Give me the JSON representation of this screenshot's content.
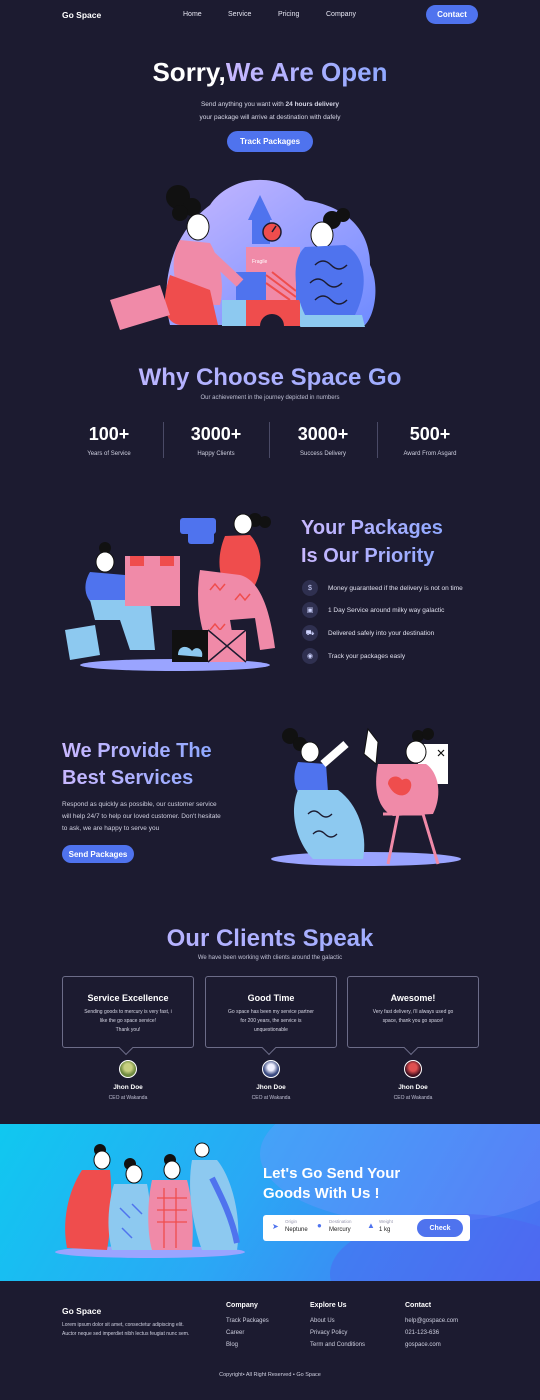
{
  "nav": {
    "logo": "Go Space",
    "links": [
      "Home",
      "Service",
      "Pricing",
      "Company"
    ],
    "contact": "Contact"
  },
  "hero": {
    "title_a": "Sorry,",
    "title_b": "We Are Open",
    "sub_pre": "Send anything you want with ",
    "sub_bold": "24 hours delivery",
    "sub_line2": "your package will arrive at destination with dafely",
    "cta": "Track Packages",
    "block_labels": [
      "Fragile",
      "Fragile"
    ]
  },
  "why": {
    "title": "Why Choose Space Go",
    "sub": "Our achievement in the journey depicted in numbers",
    "stats": [
      {
        "num": "100+",
        "label": "Years of Service"
      },
      {
        "num": "3000+",
        "label": "Happy Clients"
      },
      {
        "num": "3000+",
        "label": "Success Delivery"
      },
      {
        "num": "500+",
        "label": "Award From Asgard"
      }
    ]
  },
  "priority": {
    "title_l1": "Your Packages",
    "title_l2": "Is Our Priority",
    "features": [
      {
        "icon": "dollar-icon",
        "glyph": "$",
        "text": "Money guaranteed if the delivery is not on time"
      },
      {
        "icon": "box-icon",
        "glyph": "▣",
        "text": "1 Day Service around milky way galactic"
      },
      {
        "icon": "truck-icon",
        "glyph": "⛟",
        "text": "Delivered safely into your destination"
      },
      {
        "icon": "eye-icon",
        "glyph": "◉",
        "text": "Track your packages easly"
      }
    ]
  },
  "services": {
    "title_l1": "We Provide The",
    "title_l2": "Best Services",
    "body_l1": "Respond as quickly as possible, our customer service",
    "body_l2": "will help 24/7 to help our loved customer. Don't hesitate",
    "body_l3": "to ask, we are happy to serve you",
    "cta": "Send Packages"
  },
  "clients": {
    "title": "Our Clients Speak",
    "sub": "We have been working with clients around the galactic",
    "reviews": [
      {
        "title": "Service Excellence",
        "l1": "Sending goods to mercury is very fast, i",
        "l2": "like the go space service!",
        "l3": "Thank you!",
        "name": "Jhon Doe",
        "role": "CEO at Wakanda",
        "avatar_color": "#8aa05a"
      },
      {
        "title": "Good Time",
        "l1": "Go space has been my service partner",
        "l2": "for 200 years, the service is",
        "l3": "unquestionable",
        "name": "Jhon Doe",
        "role": "CEO at Wakanda",
        "avatar_color": "#5a6fa0"
      },
      {
        "title": "Awesome!",
        "l1": "Very fast delivery, i'll always used go",
        "l2": "space, thank you go space!",
        "l3": "",
        "name": "Jhon Doe",
        "role": "CEO at Wakanda",
        "avatar_color": "#a03a4a"
      }
    ]
  },
  "send": {
    "title_l1": "Let's Go Send Your",
    "title_l2": "Goods With Us !",
    "origin_label": "Origin",
    "origin_value": "Neptune",
    "dest_label": "Destination",
    "dest_value": "Mercury",
    "weight_label": "Weight",
    "weight_value": "1 kg",
    "check": "Check"
  },
  "footer": {
    "logo": "Go Space",
    "about_l1": "Lorem ipsum dolor sit amet, consectetur adipiscing elit.",
    "about_l2": "Auctor neque sed imperdiet nibh lectus feugiat nunc sem.",
    "company_title": "Company",
    "company_items": [
      "Track Packages",
      "Career",
      "Blog"
    ],
    "explore_title": "Explore Us",
    "explore_items": [
      "About Us",
      "Privacy Policy",
      "Term and Conditions"
    ],
    "contact_title": "Contact",
    "contact_items": [
      "help@gospace.com",
      "021-123-636",
      "gospace.com"
    ],
    "copyright": "Copyright• All Right Reserved • Go Space"
  },
  "colors": {
    "bg": "#1c1b30",
    "accent": "#4f73ee",
    "pink": "#f08aa8",
    "red": "#ef4d4d",
    "light_blue": "#8dc9f0"
  }
}
